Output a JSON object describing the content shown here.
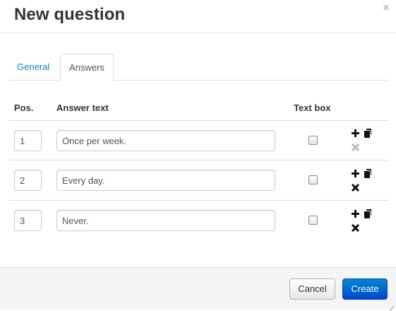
{
  "dialog": {
    "title": "New question",
    "close_icon": "close-icon"
  },
  "tabs": [
    {
      "label": "General",
      "active": false
    },
    {
      "label": "Answers",
      "active": true
    }
  ],
  "table": {
    "headers": {
      "pos": "Pos.",
      "answer_text": "Answer text",
      "text_box": "Text box"
    },
    "rows": [
      {
        "pos": "1",
        "text": "Once per week.",
        "text_box": false,
        "remove_enabled": false
      },
      {
        "pos": "2",
        "text": "Every day.",
        "text_box": false,
        "remove_enabled": true
      },
      {
        "pos": "3",
        "text": "Never.",
        "text_box": false,
        "remove_enabled": true
      }
    ],
    "row_icons": [
      "plus-icon",
      "copy-icon",
      "remove-icon"
    ]
  },
  "footer": {
    "cancel_label": "Cancel",
    "create_label": "Create"
  },
  "colors": {
    "link": "#0088cc",
    "primary_button": "#0055cc",
    "disabled_icon": "#bbbbbb"
  }
}
